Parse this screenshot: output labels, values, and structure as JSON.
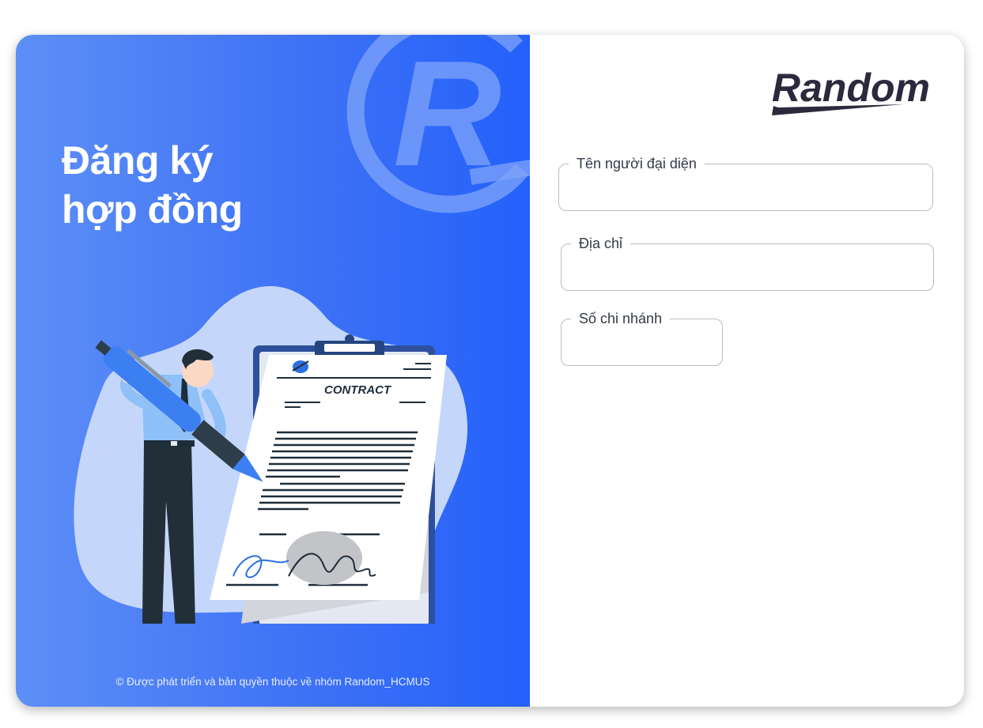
{
  "left_panel": {
    "title_line1": "Đăng ký",
    "title_line2": "hợp đồng",
    "illustration": {
      "document_heading": "CONTRACT",
      "icon": "contract-signing-illustration"
    },
    "footer": "© Được phát triển và bản quyền thuộc về nhóm Random_HCMUS"
  },
  "brand": {
    "logo_text": "Random",
    "logo_color": "#2b2a3d",
    "watermark_letter": "R"
  },
  "form": {
    "fields": [
      {
        "label": "Tên người đại diện",
        "value": ""
      },
      {
        "label": "Địa chỉ",
        "value": ""
      },
      {
        "label": "Số chi nhánh",
        "value": ""
      }
    ]
  },
  "colors": {
    "panel_gradient_start": "#5d8ff7",
    "panel_gradient_end": "#2461fb",
    "field_border": "#b9bcc4",
    "label_text": "#333a45"
  }
}
